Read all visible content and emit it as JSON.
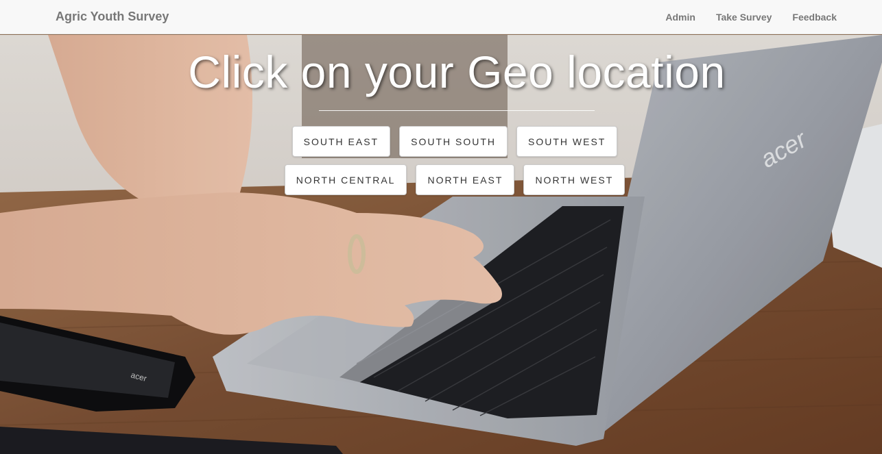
{
  "navbar": {
    "brand": "Agric Youth Survey",
    "links": [
      "Admin",
      "Take Survey",
      "Feedback"
    ]
  },
  "hero": {
    "heading": "Click on your Geo location",
    "regions_row1": [
      "SOUTH EAST",
      "SOUTH SOUTH",
      "SOUTH WEST"
    ],
    "regions_row2": [
      "NORTH CENTRAL",
      "NORTH EAST",
      "NORTH WEST"
    ],
    "laptop_logo": "acer",
    "phone_logo": "acer"
  },
  "colors": {
    "navbar_bg": "#f8f8f8",
    "navbar_text": "#777777",
    "button_bg": "#ffffff",
    "button_text": "#333333"
  }
}
